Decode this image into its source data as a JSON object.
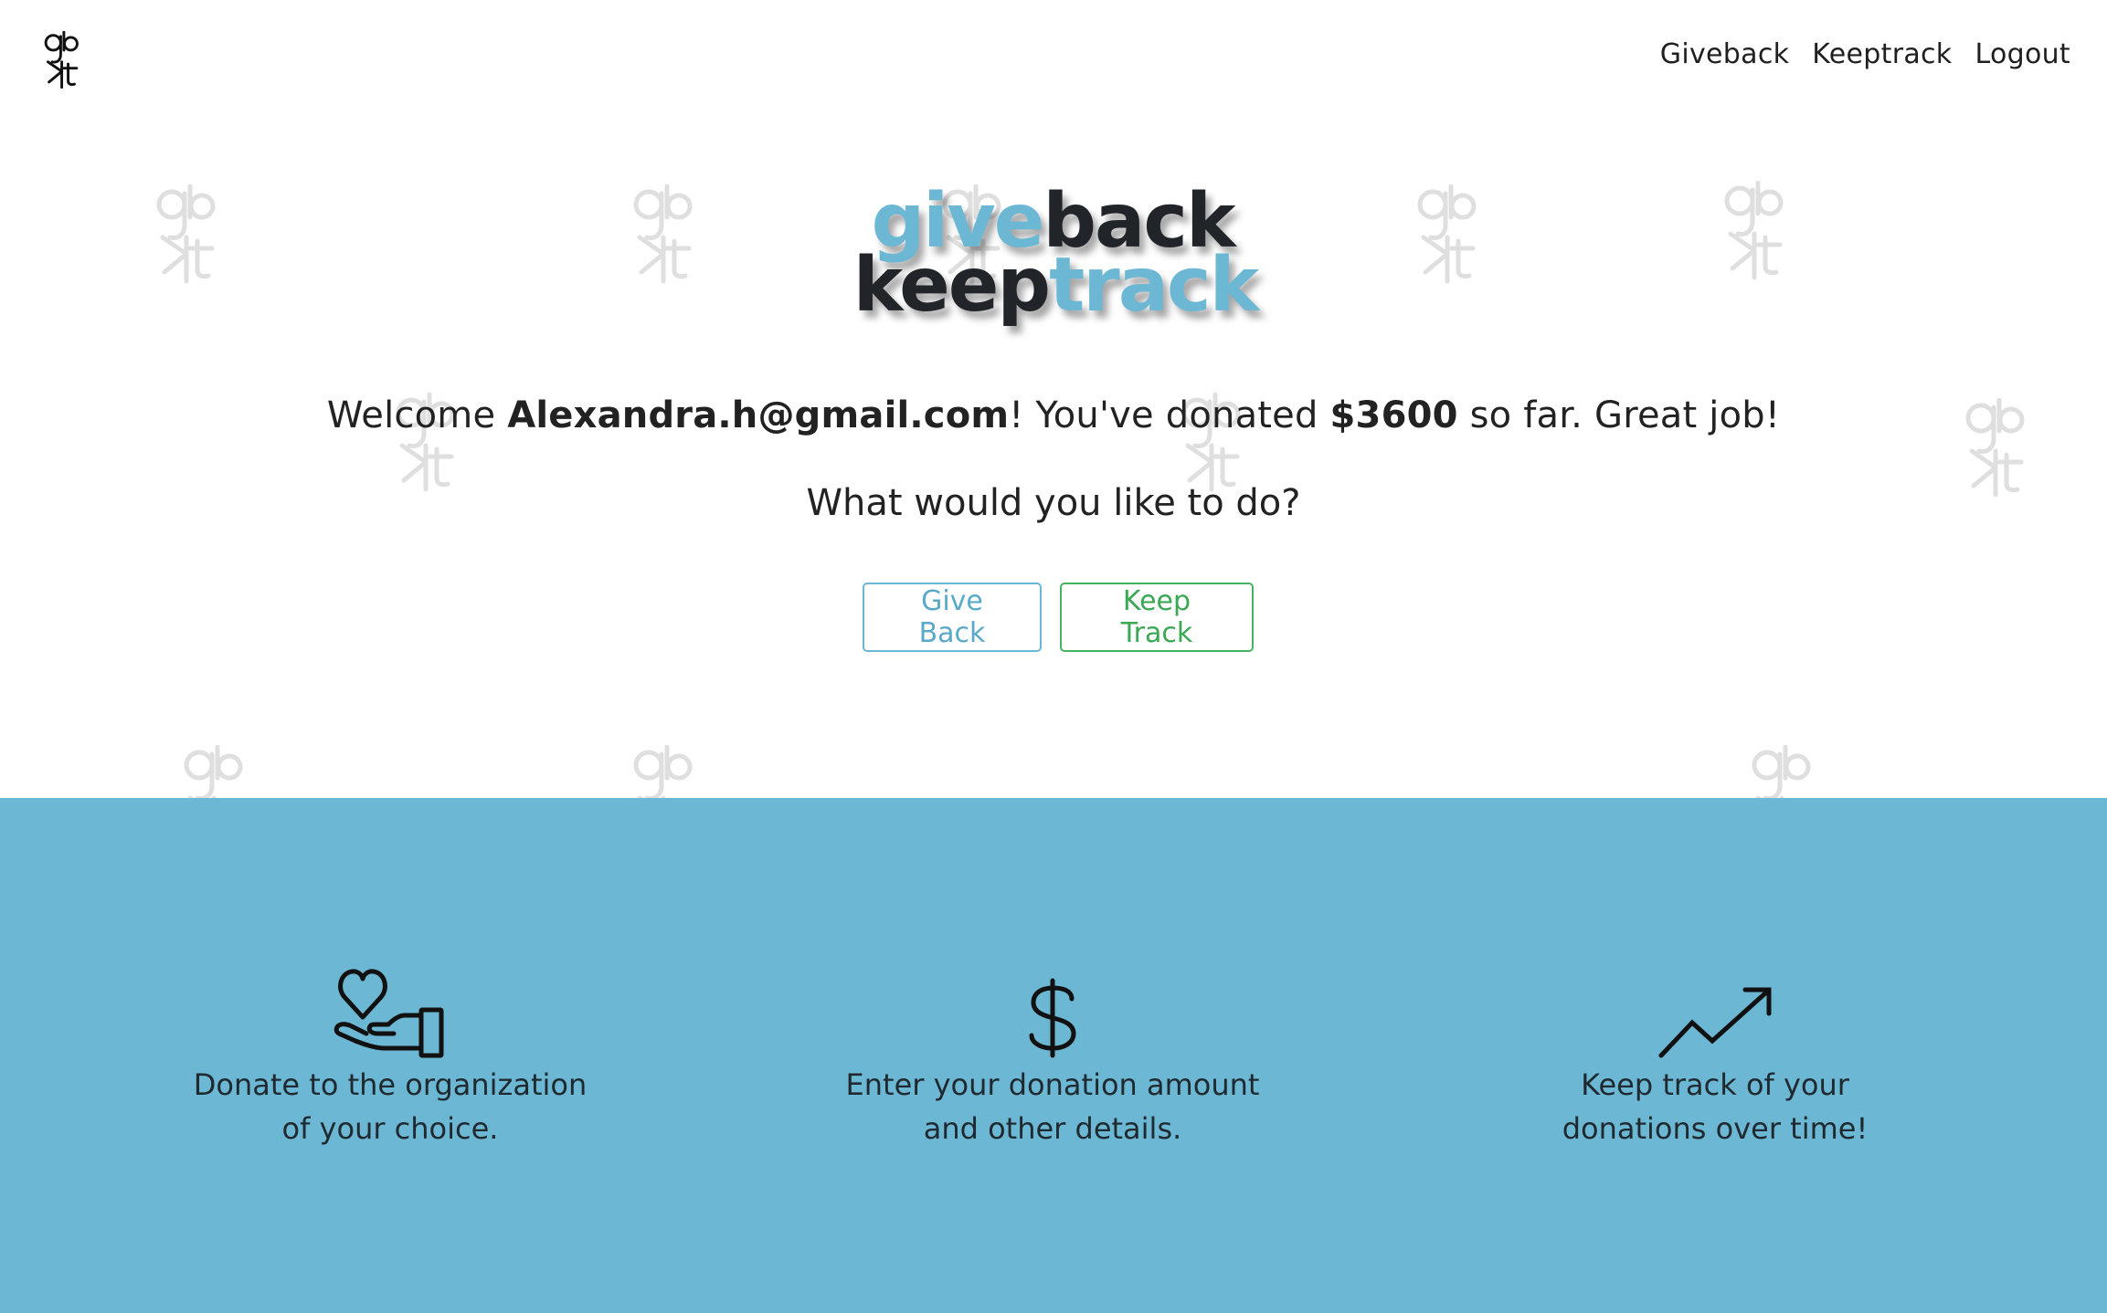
{
  "nav": {
    "brand_icon": "gb-kt-monogram-logo",
    "links": [
      "Giveback",
      "Keeptrack",
      "Logout"
    ]
  },
  "hero": {
    "title": {
      "give": "give",
      "back": "back",
      "keep": "keep",
      "track": "track"
    },
    "welcome_prefix": "Welcome ",
    "user_email": "Alexandra.h@gmail.com",
    "welcome_middle": "! You've donated ",
    "donated_amount": "$3600",
    "welcome_suffix": " so far. Great job!",
    "question": "What would you like to do?",
    "give_back_button": "Give Back",
    "keep_track_button": "Keep Track"
  },
  "features": [
    {
      "icon": "heart-hand-icon",
      "text": "Donate to the organization of your choice."
    },
    {
      "icon": "dollar-icon",
      "text": "Enter your donation amount and other details."
    },
    {
      "icon": "trend-up-icon",
      "text": "Keep track of your donations over time!"
    }
  ],
  "colors": {
    "accent_blue": "#6cb7d3",
    "accent_green": "#45b35f",
    "text_dark": "#212529"
  }
}
